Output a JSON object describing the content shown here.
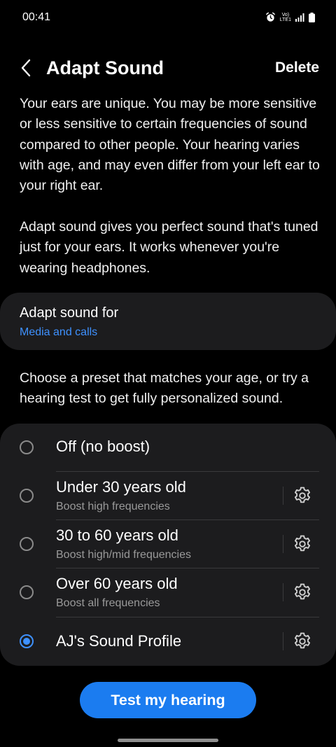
{
  "status_bar": {
    "time": "00:41",
    "network_line1": "Vo)",
    "network_line2": "LTE1"
  },
  "header": {
    "title": "Adapt Sound",
    "delete_label": "Delete"
  },
  "description_1": "Your ears are unique. You may be more sensitive or less sensitive to certain frequencies of sound compared to other people. Your hearing varies with age, and may even differ from your left ear to your right ear.",
  "description_2": "Adapt sound gives you perfect sound that's tuned just for your ears. It works whenever you're wearing headphones.",
  "adapt_for": {
    "title": "Adapt sound for",
    "value": "Media and calls"
  },
  "preset_description": "Choose a preset that matches your age, or try a hearing test to get fully personalized sound.",
  "presets": [
    {
      "title": "Off (no boost)",
      "subtitle": "",
      "selected": false
    },
    {
      "title": "Under 30 years old",
      "subtitle": "Boost high frequencies",
      "selected": false
    },
    {
      "title": "30 to 60 years old",
      "subtitle": "Boost high/mid frequencies",
      "selected": false
    },
    {
      "title": "Over 60 years old",
      "subtitle": "Boost all frequencies",
      "selected": false
    },
    {
      "title": "AJ's Sound Profile",
      "subtitle": "",
      "selected": true
    }
  ],
  "test_button_label": "Test my hearing",
  "colors": {
    "accent": "#3e91ff",
    "button": "#1b7cf0",
    "card": "#1c1c1e",
    "background": "#000000"
  }
}
